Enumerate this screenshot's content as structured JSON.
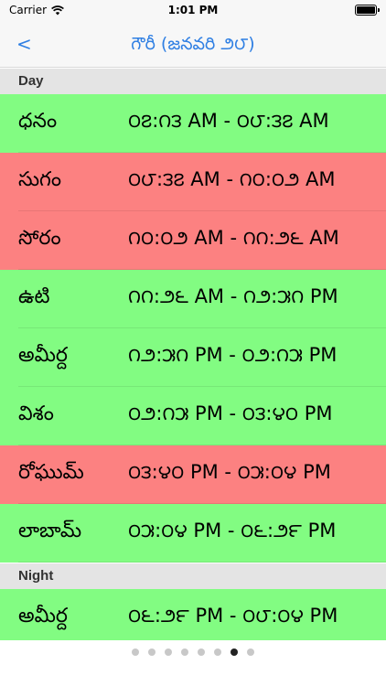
{
  "status_bar": {
    "carrier": "Carrier",
    "time": "1:01 PM"
  },
  "nav": {
    "back_label": "<",
    "title": "గౌరీ (జనవరి ౨౮)"
  },
  "sections": {
    "day": "Day",
    "night": "Night"
  },
  "day_rows": [
    {
      "name": "ధనం",
      "time": "౦౭:౧౩ AM - ౦౮:౩౭ AM",
      "status": "good"
    },
    {
      "name": "సుగం",
      "time": "౦౮:౩౭ AM - ౧౦:౦౨ AM",
      "status": "bad"
    },
    {
      "name": "సోరం",
      "time": "౧౦:౦౨ AM - ౧౧:౨౬ AM",
      "status": "bad"
    },
    {
      "name": "ఉటి",
      "time": "౧౧:౨౬ AM - ౧౨:౫౧ PM",
      "status": "good"
    },
    {
      "name": "అమీర్ద",
      "time": "౧౨:౫౧ PM - ౦౨:౧౫ PM",
      "status": "good"
    },
    {
      "name": "విశం",
      "time": "౦౨:౧౫ PM - ౦౩:౪౦ PM",
      "status": "good"
    },
    {
      "name": "రోఘుమ్",
      "time": "౦౩:౪౦ PM - ౦౫:౦౪ PM",
      "status": "bad"
    },
    {
      "name": "లాబామ్",
      "time": "౦౫:౦౪ PM - ౦౬:౨౯ PM",
      "status": "good"
    }
  ],
  "night_rows": [
    {
      "name": "అమీర్ద",
      "time": "౦౬:౨౯ PM - ౦౮:౦౪ PM",
      "status": "good"
    }
  ],
  "page_indicator": {
    "total": 8,
    "current": 7
  },
  "colors": {
    "good": "#82fc82",
    "bad": "#fc8181",
    "accent": "#2f7fe3"
  },
  "icons": {
    "signal": "wifi-icon",
    "battery": "battery-icon"
  }
}
